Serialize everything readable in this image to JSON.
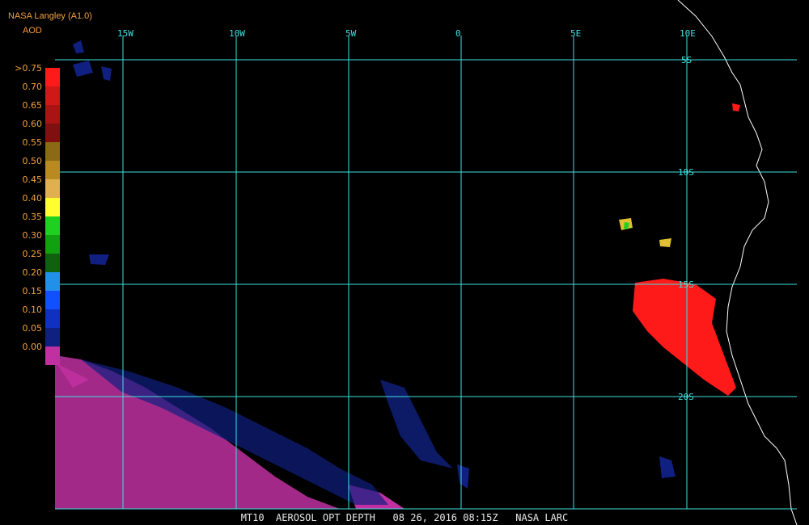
{
  "header": {
    "source": "NASA Langley (A1.0)",
    "product": "AOD"
  },
  "colorbar": {
    "labels": [
      ">0.75",
      "0.70",
      "0.65",
      "0.60",
      "0.55",
      "0.50",
      "0.45",
      "0.40",
      "0.35",
      "0.30",
      "0.25",
      "0.20",
      "0.15",
      "0.10",
      "0.05",
      "0.00"
    ],
    "colors": [
      "#ff1a1a",
      "#d01818",
      "#a81414",
      "#801010",
      "#8a6a14",
      "#b88a20",
      "#e0b050",
      "#ffff30",
      "#20d020",
      "#10a010",
      "#106010",
      "#2090e8",
      "#1050ff",
      "#1030c0",
      "#102080",
      "#c030a0"
    ]
  },
  "grid": {
    "lon_labels": [
      "15W",
      "10W",
      "5W",
      "0",
      "5E",
      "10E"
    ],
    "lat_labels": [
      "5S",
      "10S",
      "15S",
      "20S"
    ],
    "line_color": "#40e0e0"
  },
  "footer": {
    "text": "MT10  AEROSOL OPT DEPTH   08 26, 2016 08:15Z   NASA LARC"
  }
}
